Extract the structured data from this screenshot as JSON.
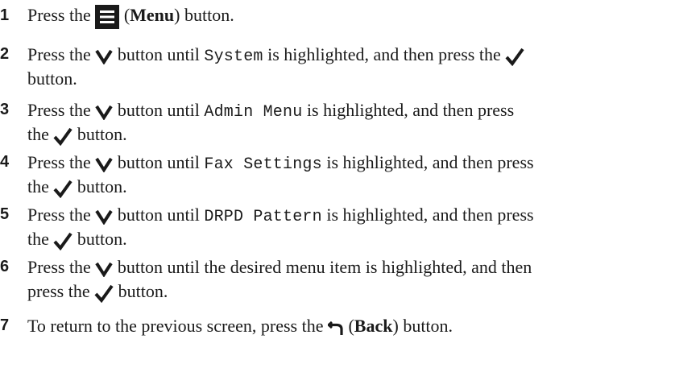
{
  "steps": [
    {
      "number": "1",
      "lines": [
        {
          "pre": "Press the ",
          "icon": "menu-icon",
          "post": " button.",
          "label": "Menu"
        }
      ]
    },
    {
      "number": "2",
      "lines": [
        {
          "pre": "Press the ",
          "icon": "down-arrow-icon",
          "mid": " button until ",
          "code": "System",
          "post": " is highlighted, and then press the ",
          "icon2": "check-icon"
        },
        {
          "text": "button."
        }
      ]
    },
    {
      "number": "3",
      "lines": [
        {
          "pre": "Press the ",
          "icon": "down-arrow-icon",
          "mid": " button until ",
          "code": "Admin Menu",
          "post": " is highlighted, and then press"
        },
        {
          "pre": "the ",
          "icon": "check-icon",
          "post": " button."
        }
      ]
    },
    {
      "number": "4",
      "lines": [
        {
          "pre": "Press the ",
          "icon": "down-arrow-icon",
          "mid": " button until ",
          "code": "Fax Settings",
          "post": " is highlighted, and then press"
        },
        {
          "pre": "the ",
          "icon": "check-icon",
          "post": " button."
        }
      ]
    },
    {
      "number": "5",
      "lines": [
        {
          "pre": "Press the ",
          "icon": "down-arrow-icon",
          "mid": " button until ",
          "code": "DRPD Pattern",
          "post": " is highlighted, and then press"
        },
        {
          "pre": "the ",
          "icon": "check-icon",
          "post": " button."
        }
      ]
    },
    {
      "number": "6",
      "lines": [
        {
          "pre": "Press the ",
          "icon": "down-arrow-icon",
          "mid": " button until the desired menu item is highlighted, and then"
        },
        {
          "pre": "press the ",
          "icon": "check-icon",
          "post": " button."
        }
      ]
    },
    {
      "number": "7",
      "lines": [
        {
          "pre": "To return to the previous screen, press the ",
          "icon": "back-icon",
          "post": " button.",
          "label": "Back"
        }
      ]
    }
  ]
}
